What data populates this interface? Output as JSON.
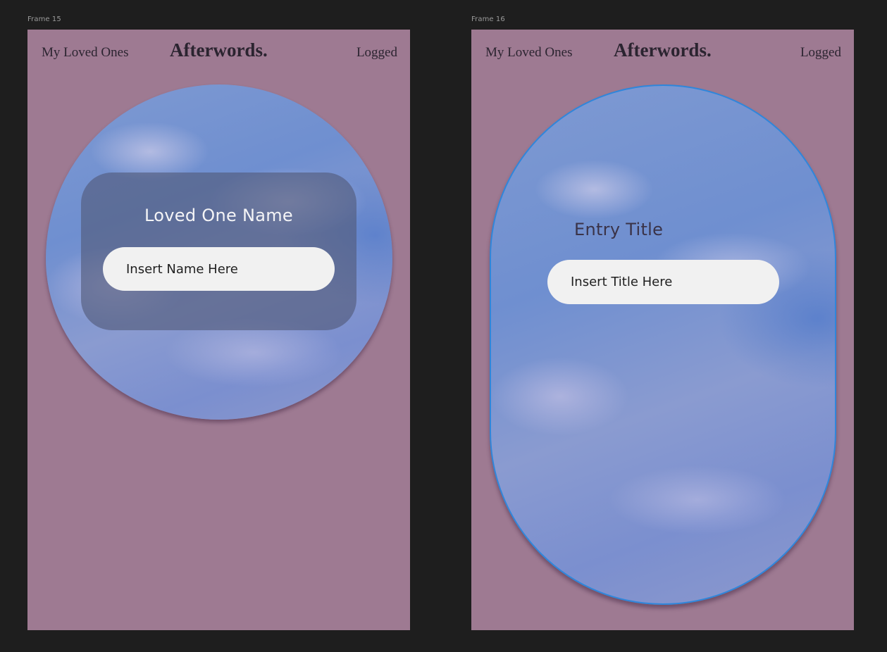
{
  "frames": [
    {
      "label": "Frame 15",
      "nav": {
        "left_link": "My Loved Ones",
        "brand": "Afterwords.",
        "right_link": "Logged"
      },
      "card": {
        "title": "Loved One Name",
        "input_placeholder": "Insert Name Here"
      }
    },
    {
      "label": "Frame 16",
      "nav": {
        "left_link": "My Loved Ones",
        "brand": "Afterwords.",
        "right_link": "Logged"
      },
      "card": {
        "title": "Entry Title",
        "input_placeholder": "Insert Title Here"
      }
    }
  ],
  "colors": {
    "canvas_bg": "#1e1e1e",
    "frame_bg": "#9e7a92",
    "selection_outline": "#2f86db",
    "input_bg": "#f1f1f1"
  }
}
